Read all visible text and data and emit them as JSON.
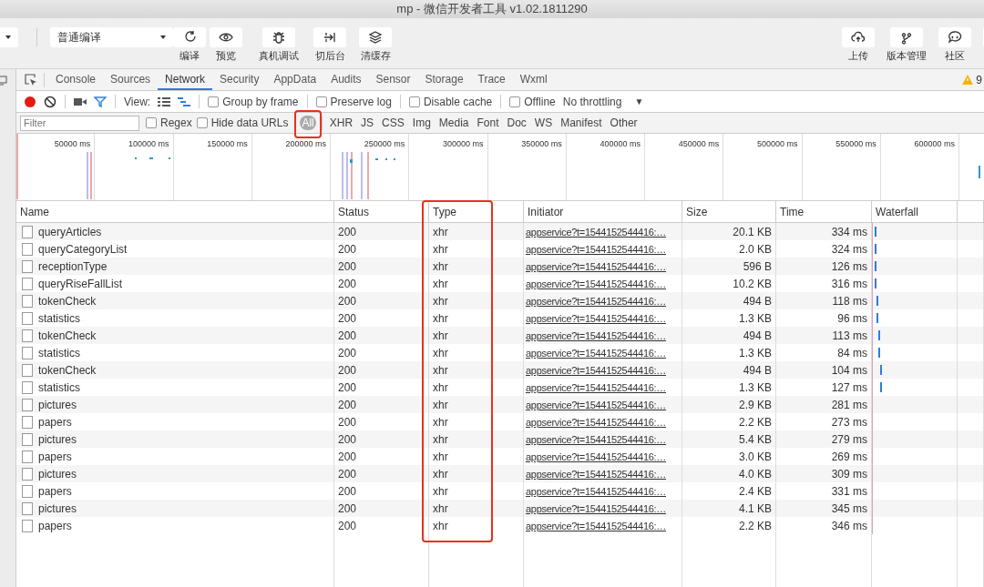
{
  "window": {
    "title": "mp - 微信开发者工具 v1.02.1811290"
  },
  "toolbar": {
    "compile_mode": "普通编译",
    "left_buttons": [
      {
        "kind": "compile",
        "label": "编译"
      },
      {
        "kind": "preview",
        "label": "预览"
      },
      {
        "kind": "debug",
        "label": "真机调试"
      },
      {
        "kind": "background",
        "label": "切后台"
      },
      {
        "kind": "cache",
        "label": "清缓存"
      }
    ],
    "right_buttons": [
      {
        "kind": "upload",
        "label": "上传"
      },
      {
        "kind": "version",
        "label": "版本管理"
      },
      {
        "kind": "community",
        "label": "社区"
      }
    ]
  },
  "devtools_tabs": [
    {
      "label": "Console",
      "selected": false
    },
    {
      "label": "Sources",
      "selected": false
    },
    {
      "label": "Network",
      "selected": true
    },
    {
      "label": "Security",
      "selected": false
    },
    {
      "label": "AppData",
      "selected": false
    },
    {
      "label": "Audits",
      "selected": false
    },
    {
      "label": "Sensor",
      "selected": false
    },
    {
      "label": "Storage",
      "selected": false
    },
    {
      "label": "Trace",
      "selected": false
    },
    {
      "label": "Wxml",
      "selected": false
    }
  ],
  "warning_count": "9",
  "network_controls": {
    "view_label": "View:",
    "views": [
      {
        "kind": "list",
        "selected": false
      },
      {
        "kind": "waterfall",
        "selected": true
      }
    ],
    "options": [
      {
        "label": "Group by frame",
        "checked": false
      },
      {
        "label": "Preserve log",
        "checked": false
      },
      {
        "label": "Disable cache",
        "checked": false
      },
      {
        "label": "Offline",
        "checked": false
      }
    ],
    "throttling": "No throttling",
    "throttling_caret": "▼"
  },
  "filter_bar": {
    "placeholder": "Filter",
    "options": [
      {
        "label": "Regex",
        "checked": false
      },
      {
        "label": "Hide data URLs",
        "checked": false
      }
    ],
    "types": [
      {
        "label": "All",
        "selected": true
      },
      {
        "label": "XHR",
        "selected": false
      },
      {
        "label": "JS",
        "selected": false
      },
      {
        "label": "CSS",
        "selected": false
      },
      {
        "label": "Img",
        "selected": false
      },
      {
        "label": "Media",
        "selected": false
      },
      {
        "label": "Font",
        "selected": false
      },
      {
        "label": "Doc",
        "selected": false
      },
      {
        "label": "WS",
        "selected": false
      },
      {
        "label": "Manifest",
        "selected": false
      },
      {
        "label": "Other",
        "selected": false
      }
    ]
  },
  "overview_ticks": [
    "50000 ms",
    "100000 ms",
    "150000 ms",
    "200000 ms",
    "250000 ms",
    "300000 ms",
    "350000 ms",
    "400000 ms",
    "450000 ms",
    "500000 ms",
    "550000 ms",
    "600000 ms"
  ],
  "table": {
    "columns": [
      "Name",
      "Status",
      "Type",
      "Initiator",
      "Size",
      "Time",
      "Waterfall"
    ],
    "rows": [
      [
        "queryArticles",
        "200",
        "xhr",
        "appservice?t=1544152544416:…",
        "20.1 KB",
        "334 ms"
      ],
      [
        "queryCategoryList",
        "200",
        "xhr",
        "appservice?t=1544152544416:…",
        "2.0 KB",
        "324 ms"
      ],
      [
        "receptionType",
        "200",
        "xhr",
        "appservice?t=1544152544416:…",
        "596 B",
        "126 ms"
      ],
      [
        "queryRiseFallList",
        "200",
        "xhr",
        "appservice?t=1544152544416:…",
        "10.2 KB",
        "316 ms"
      ],
      [
        "tokenCheck",
        "200",
        "xhr",
        "appservice?t=1544152544416:…",
        "494 B",
        "118 ms"
      ],
      [
        "statistics",
        "200",
        "xhr",
        "appservice?t=1544152544416:…",
        "1.3 KB",
        "96 ms"
      ],
      [
        "tokenCheck",
        "200",
        "xhr",
        "appservice?t=1544152544416:…",
        "494 B",
        "113 ms"
      ],
      [
        "statistics",
        "200",
        "xhr",
        "appservice?t=1544152544416:…",
        "1.3 KB",
        "84 ms"
      ],
      [
        "tokenCheck",
        "200",
        "xhr",
        "appservice?t=1544152544416:…",
        "494 B",
        "104 ms"
      ],
      [
        "statistics",
        "200",
        "xhr",
        "appservice?t=1544152544416:…",
        "1.3 KB",
        "127 ms"
      ],
      [
        "pictures",
        "200",
        "xhr",
        "appservice?t=1544152544416:…",
        "2.9 KB",
        "281 ms"
      ],
      [
        "papers",
        "200",
        "xhr",
        "appservice?t=1544152544416:…",
        "2.2 KB",
        "273 ms"
      ],
      [
        "pictures",
        "200",
        "xhr",
        "appservice?t=1544152544416:…",
        "5.4 KB",
        "279 ms"
      ],
      [
        "papers",
        "200",
        "xhr",
        "appservice?t=1544152544416:…",
        "3.0 KB",
        "269 ms"
      ],
      [
        "pictures",
        "200",
        "xhr",
        "appservice?t=1544152544416:…",
        "4.0 KB",
        "309 ms"
      ],
      [
        "papers",
        "200",
        "xhr",
        "appservice?t=1544152544416:…",
        "2.4 KB",
        "331 ms"
      ],
      [
        "pictures",
        "200",
        "xhr",
        "appservice?t=1544152544416:…",
        "4.1 KB",
        "345 ms"
      ],
      [
        "papers",
        "200",
        "xhr",
        "appservice?t=1544152544416:…",
        "2.2 KB",
        "346 ms"
      ]
    ]
  }
}
